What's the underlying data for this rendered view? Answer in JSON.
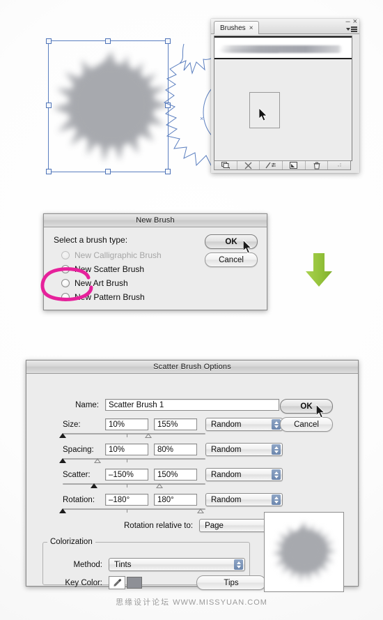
{
  "artwork": {
    "selection_handles": 8,
    "center_mark": "×",
    "selection_color": "#5b7fc0"
  },
  "brushes_panel": {
    "tab_label": "Brushes",
    "tab_close_glyph": "×",
    "minimize_glyph": "–",
    "close_glyph": "×",
    "footer_icons": [
      "brush-libraries-icon",
      "remove-brush-stroke-icon",
      "brush-options-icon",
      "new-brush-icon",
      "delete-brush-icon"
    ]
  },
  "new_brush_dialog": {
    "title": "New Brush",
    "prompt": "Select a brush type:",
    "options": [
      {
        "label": "New Calligraphic Brush",
        "selected": false,
        "disabled": true
      },
      {
        "label": "New Scatter Brush",
        "selected": true,
        "disabled": false
      },
      {
        "label": "New Art Brush",
        "selected": false,
        "disabled": false
      },
      {
        "label": "New Pattern Brush",
        "selected": false,
        "disabled": false
      }
    ],
    "ok_label": "OK",
    "cancel_label": "Cancel",
    "annotation_color": "#e6219b"
  },
  "green_arrow": {
    "color": "#95c33b",
    "direction": "down"
  },
  "scatter_dialog": {
    "title": "Scatter Brush Options",
    "name_label": "Name:",
    "name_value": "Scatter Brush 1",
    "rows": [
      {
        "label": "Size:",
        "min": "10%",
        "max": "155%",
        "mode": "Random",
        "marker_min_pct": 0,
        "marker_max_pct": 60,
        "tick_pct": 45
      },
      {
        "label": "Spacing:",
        "min": "10%",
        "max": "80%",
        "mode": "Random",
        "marker_min_pct": 0,
        "marker_max_pct": 24,
        "tick_pct": 45
      },
      {
        "label": "Scatter:",
        "min": "–150%",
        "max": "150%",
        "mode": "Random",
        "marker_min_pct": 22,
        "marker_max_pct": 68,
        "tick_pct": 45
      },
      {
        "label": "Rotation:",
        "min": "–180°",
        "max": "180°",
        "mode": "Random",
        "marker_min_pct": 0,
        "marker_max_pct": 95,
        "tick_pct": 45
      }
    ],
    "rotation_relative_label": "Rotation relative to:",
    "rotation_relative_value": "Page",
    "colorization_legend": "Colorization",
    "method_label": "Method:",
    "method_value": "Tints",
    "key_color_label": "Key Color:",
    "key_color_swatch": "#8e9096",
    "tips_label": "Tips",
    "ok_label": "OK",
    "cancel_label": "Cancel"
  },
  "watermark": {
    "cn": "思缘设计论坛",
    "url": "WWW.MISSYUAN.COM"
  }
}
